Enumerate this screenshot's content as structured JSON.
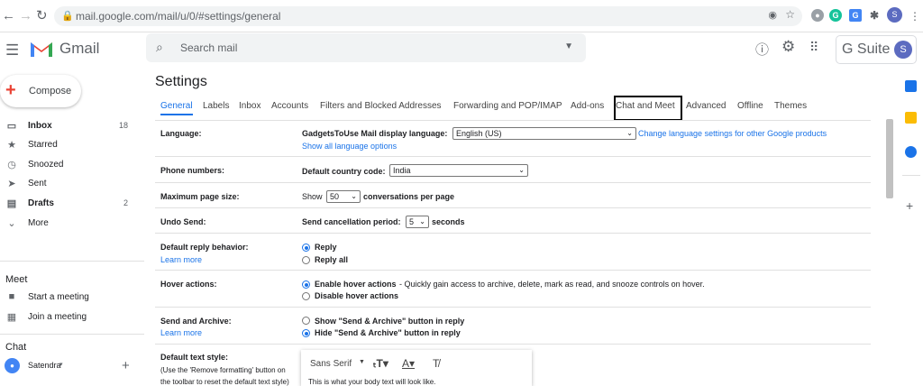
{
  "browser": {
    "url": "mail.google.com/mail/u/0/#settings/general",
    "profile_initial": "S"
  },
  "header": {
    "app_name": "Gmail",
    "search_placeholder": "Search mail",
    "gsuite_label": "G Suite",
    "avatar_initial": "S"
  },
  "sidebar": {
    "compose_label": "Compose",
    "items": [
      {
        "label": "Inbox",
        "count": "18",
        "icon": "inbox-icon"
      },
      {
        "label": "Starred",
        "count": "",
        "icon": "star-icon"
      },
      {
        "label": "Snoozed",
        "count": "",
        "icon": "clock-icon"
      },
      {
        "label": "Sent",
        "count": "",
        "icon": "send-icon"
      },
      {
        "label": "Drafts",
        "count": "2",
        "icon": "draft-icon"
      },
      {
        "label": "More",
        "count": "",
        "icon": "chevron-down-icon"
      }
    ],
    "meet_heading": "Meet",
    "meet_items": [
      {
        "label": "Start a meeting",
        "icon": "video-icon"
      },
      {
        "label": "Join a meeting",
        "icon": "keyboard-icon"
      }
    ],
    "chat_heading": "Chat",
    "chat_user": "Satendra"
  },
  "settings": {
    "title": "Settings",
    "tabs": [
      "General",
      "Labels",
      "Inbox",
      "Accounts",
      "Filters and Blocked Addresses",
      "Forwarding and POP/IMAP",
      "Add-ons",
      "Chat and Meet",
      "Advanced",
      "Offline",
      "Themes"
    ],
    "active_tab": "General",
    "highlighted_tab": "Chat and Meet",
    "rows": {
      "language": {
        "label": "Language:",
        "field_label": "GadgetsToUse Mail display language:",
        "value": "English (US)",
        "change_link": "Change language settings for other Google products",
        "show_all_link": "Show all language options"
      },
      "phone": {
        "label": "Phone numbers:",
        "field_label": "Default country code:",
        "value": "India"
      },
      "page_size": {
        "label": "Maximum page size:",
        "prefix": "Show",
        "value": "50",
        "suffix": "conversations per page"
      },
      "undo": {
        "label": "Undo Send:",
        "field_label": "Send cancellation period:",
        "value": "5",
        "suffix": "seconds"
      },
      "reply": {
        "label": "Default reply behavior:",
        "learn_more": "Learn more",
        "options": [
          "Reply",
          "Reply all"
        ],
        "selected": "Reply"
      },
      "hover": {
        "label": "Hover actions:",
        "enable_label": "Enable hover actions",
        "enable_desc": "- Quickly gain access to archive, delete, mark as read, and snooze controls on hover.",
        "disable_label": "Disable hover actions",
        "selected": "Enable hover actions"
      },
      "send_archive": {
        "label": "Send and Archive:",
        "learn_more": "Learn more",
        "show_label": "Show \"Send & Archive\" button in reply",
        "hide_label": "Hide \"Send & Archive\" button in reply",
        "selected": "Hide"
      },
      "text_style": {
        "label": "Default text style:",
        "desc1": "(Use the 'Remove formatting' button on",
        "desc2": "the toolbar to reset the default text style)",
        "font": "Sans Serif",
        "preview": "This is what your body text will look like."
      }
    }
  },
  "colors": {
    "accent": "#1a73e8",
    "gmail_red": "#ea4335"
  }
}
